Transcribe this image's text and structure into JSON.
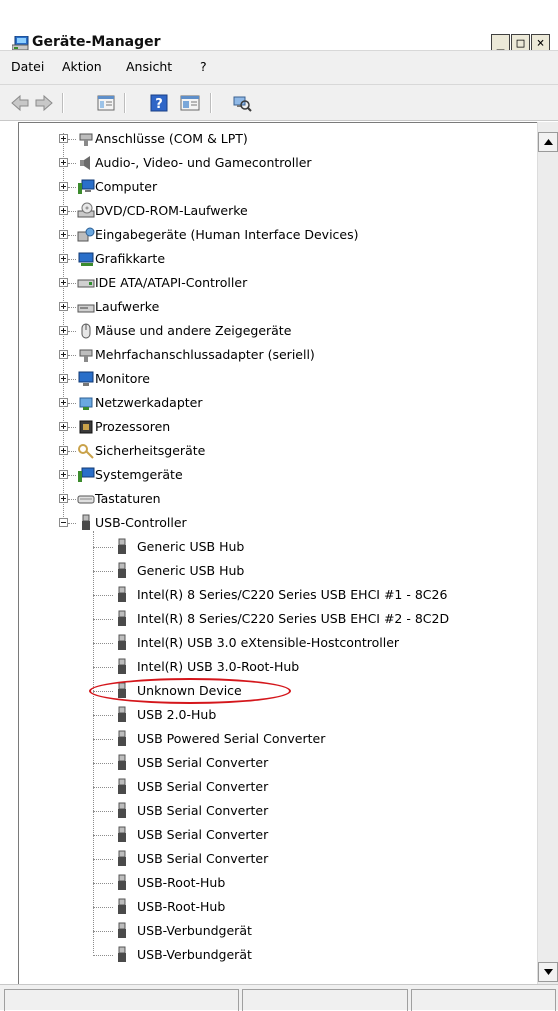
{
  "window": {
    "title": "Geräte-Manager",
    "controls": [
      "minimize",
      "maximize",
      "close"
    ]
  },
  "menu": [
    "Datei",
    "Aktion",
    "Ansicht",
    "?"
  ],
  "toolbar": {
    "buttons": [
      "back-icon",
      "forward-icon",
      "properties-view-icon",
      "help-icon",
      "show-hide-console-tree-icon",
      "scan-hardware-icon"
    ]
  },
  "tree": {
    "categories": [
      {
        "label": "Anschlüsse (COM & LPT)",
        "icon": "port-icon"
      },
      {
        "label": "Audio-, Video- und Gamecontroller",
        "icon": "speaker-icon"
      },
      {
        "label": "Computer",
        "icon": "computer-icon"
      },
      {
        "label": "DVD/CD-ROM-Laufwerke",
        "icon": "optical-drive-icon"
      },
      {
        "label": "Eingabegeräte (Human Interface Devices)",
        "icon": "hid-icon"
      },
      {
        "label": "Grafikkarte",
        "icon": "display-adapter-icon"
      },
      {
        "label": "IDE ATA/ATAPI-Controller",
        "icon": "ide-controller-icon"
      },
      {
        "label": "Laufwerke",
        "icon": "disk-drive-icon"
      },
      {
        "label": "Mäuse und andere Zeigegeräte",
        "icon": "mouse-icon"
      },
      {
        "label": "Mehrfachanschlussadapter (seriell)",
        "icon": "multiport-icon"
      },
      {
        "label": "Monitore",
        "icon": "monitor-icon"
      },
      {
        "label": "Netzwerkadapter",
        "icon": "network-adapter-icon"
      },
      {
        "label": "Prozessoren",
        "icon": "processor-icon"
      },
      {
        "label": "Sicherheitsgeräte",
        "icon": "security-device-icon"
      },
      {
        "label": "Systemgeräte",
        "icon": "system-device-icon"
      },
      {
        "label": "Tastaturen",
        "icon": "keyboard-icon"
      }
    ],
    "usb": {
      "label": "USB-Controller",
      "icon": "usb-plug-icon",
      "expanded": true,
      "children": [
        "Generic USB Hub",
        "Generic USB Hub",
        "Intel(R) 8 Series/C220 Series USB EHCI #1 - 8C26",
        "Intel(R) 8 Series/C220 Series USB EHCI #2 - 8C2D",
        "Intel(R) USB 3.0 eXtensible-Hostcontroller",
        "Intel(R) USB 3.0-Root-Hub",
        "Unknown Device",
        "USB 2.0-Hub",
        "USB Powered Serial Converter",
        "USB Serial Converter",
        "USB Serial Converter",
        "USB Serial Converter",
        "USB Serial Converter",
        "USB Serial Converter",
        "USB-Root-Hub",
        "USB-Root-Hub",
        "USB-Verbundgerät",
        "USB-Verbundgerät"
      ],
      "highlighted": "Unknown Device"
    }
  },
  "colors": {
    "highlight": "#d4161b",
    "menubar_bg": "#f0f0f0",
    "tree_bg": "#ffffff"
  }
}
